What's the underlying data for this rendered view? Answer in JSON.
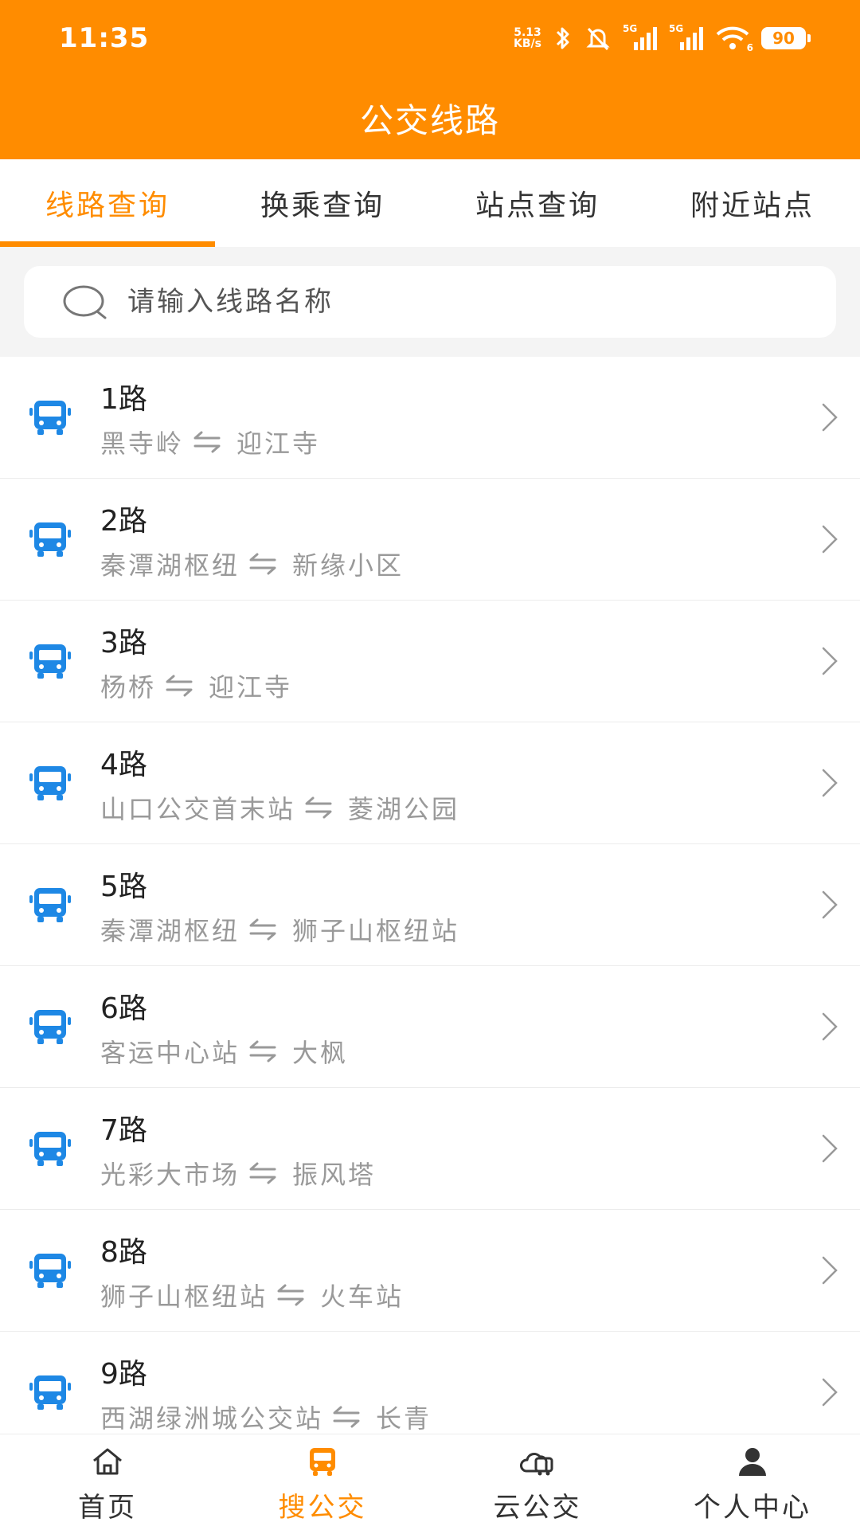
{
  "status_bar": {
    "time": "11:35",
    "net_speed_value": "5.13",
    "net_speed_unit": "KB/s",
    "signal1_label": "5G",
    "signal2_label": "5G",
    "wifi_sub": "6",
    "battery": "90"
  },
  "header": {
    "title": "公交线路"
  },
  "tabs": [
    {
      "label": "线路查询"
    },
    {
      "label": "换乘查询"
    },
    {
      "label": "站点查询"
    },
    {
      "label": "附近站点"
    }
  ],
  "search": {
    "placeholder": "请输入线路名称"
  },
  "routes": [
    {
      "name": "1路",
      "from": "黑寺岭",
      "to": "迎江寺"
    },
    {
      "name": "2路",
      "from": "秦潭湖枢纽",
      "to": "新缘小区"
    },
    {
      "name": "3路",
      "from": "杨桥",
      "to": "迎江寺"
    },
    {
      "name": "4路",
      "from": "山口公交首末站",
      "to": "菱湖公园"
    },
    {
      "name": "5路",
      "from": "秦潭湖枢纽",
      "to": "狮子山枢纽站"
    },
    {
      "name": "6路",
      "from": "客运中心站",
      "to": "大枫"
    },
    {
      "name": "7路",
      "from": "光彩大市场",
      "to": "振风塔"
    },
    {
      "name": "8路",
      "from": "狮子山枢纽站",
      "to": "火车站"
    },
    {
      "name": "9路",
      "from": "西湖绿洲城公交站",
      "to": "长青"
    }
  ],
  "bottom_nav": [
    {
      "label": "首页",
      "icon": "home-icon"
    },
    {
      "label": "搜公交",
      "icon": "bus-icon"
    },
    {
      "label": "云公交",
      "icon": "cloud-bus-icon"
    },
    {
      "label": "个人中心",
      "icon": "user-icon"
    }
  ],
  "colors": {
    "accent": "#ff8c00",
    "bus_icon": "#1e88e5",
    "subtext": "#999999"
  }
}
